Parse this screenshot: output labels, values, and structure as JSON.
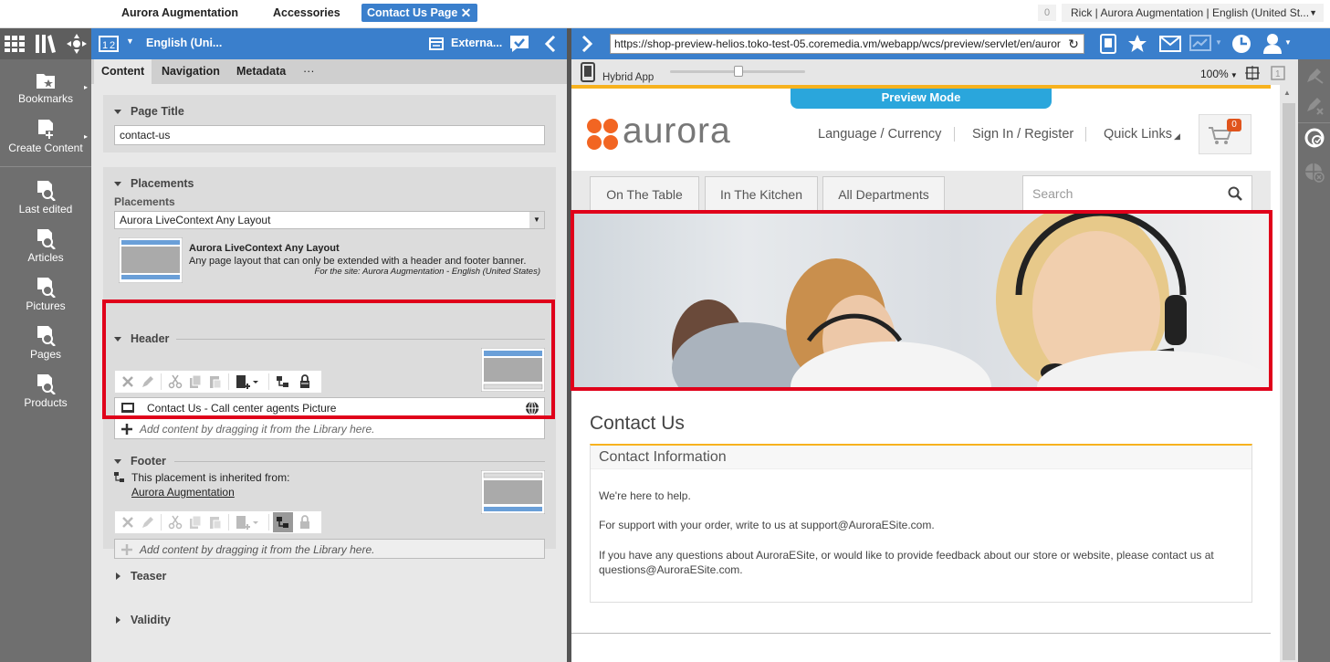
{
  "top_tabs": [
    {
      "label": "Aurora Augmentation"
    },
    {
      "label": "Accessories"
    },
    {
      "label": "Contact Us Page"
    }
  ],
  "notification_count": "0",
  "user_menu": "Rick | Aurora Augmentation | English (United St...",
  "left_nav": [
    {
      "label": "Bookmarks",
      "icon": "bookmark-icon"
    },
    {
      "label": "Create Content",
      "icon": "create-content-icon"
    },
    {
      "label": "Last edited",
      "icon": "search-doc-icon"
    },
    {
      "label": "Articles",
      "icon": "search-doc-icon"
    },
    {
      "label": "Pictures",
      "icon": "search-doc-icon"
    },
    {
      "label": "Pages",
      "icon": "search-doc-icon"
    },
    {
      "label": "Products",
      "icon": "search-doc-icon"
    }
  ],
  "editor": {
    "locale": "English (Uni...",
    "external_label": "Externa...",
    "tabs": [
      "Content",
      "Navigation",
      "Metadata",
      "···"
    ],
    "page_title": {
      "title": "Page Title",
      "value": "contact-us"
    },
    "placements": {
      "title": "Placements",
      "label": "Placements",
      "layout_value": "Aurora LiveContext Any Layout",
      "layout_name": "Aurora LiveContext Any Layout",
      "layout_desc": "Any page layout that can only be extended with a header and footer banner.",
      "layout_site": "For the site: Aurora Augmentation - English (United States)"
    },
    "header": {
      "title": "Header",
      "item": "Contact Us - Call center agents Picture",
      "add_hint": "Add content by dragging it from the Library here."
    },
    "footer": {
      "title": "Footer",
      "inherited_text": "This placement is inherited from:",
      "inherited_link": "Aurora Augmentation",
      "add_hint": "Add content by dragging it from the Library here."
    },
    "teaser": "Teaser",
    "validity": "Validity"
  },
  "preview": {
    "url": "https://shop-preview-helios.toko-test-05.coremedia.vm/webapp/wcs/preview/servlet/en/auror",
    "device": "Hybrid App",
    "zoom": "100%",
    "mode_label": "Preview Mode",
    "site": {
      "logo_text": "aurora",
      "nav": [
        "Language / Currency",
        "Sign In / Register",
        "Quick Links"
      ],
      "cart_count": "0",
      "departments": [
        "On The Table",
        "In The Kitchen",
        "All Departments"
      ],
      "search_placeholder": "Search",
      "page_heading": "Contact Us",
      "info_heading": "Contact Information",
      "paragraphs": [
        "We're here to help.",
        "For support with your order, write to us at support@AuroraESite.com.",
        "If you have any questions about AuroraESite, or would like to provide feedback about our store or website, please contact us at questions@AuroraESite.com."
      ]
    }
  },
  "colors": {
    "brand_blue": "#3a7fcc",
    "highlight_red": "#e0001a",
    "aurora_orange": "#f26522",
    "preview_cyan": "#2aa6dc"
  }
}
